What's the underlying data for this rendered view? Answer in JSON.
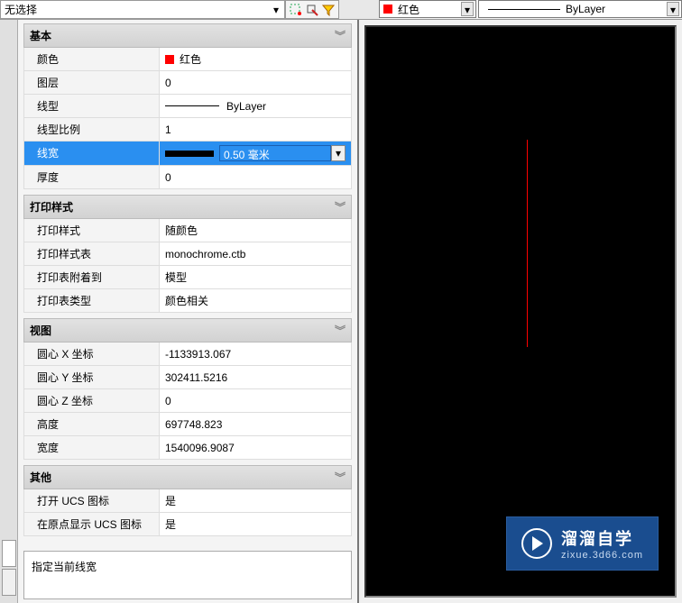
{
  "selection": {
    "label": "无选择"
  },
  "topRight": {
    "color": {
      "swatch": "#f00",
      "label": "红色"
    },
    "linetype": "ByLayer"
  },
  "groups": {
    "basic": {
      "title": "基本",
      "color": {
        "label": "颜色",
        "value": "红色"
      },
      "layer": {
        "label": "图层",
        "value": "0"
      },
      "linetype": {
        "label": "线型",
        "value": "ByLayer"
      },
      "ltscale": {
        "label": "线型比例",
        "value": "1"
      },
      "lineweight": {
        "label": "线宽",
        "value": "0.50 毫米"
      },
      "thickness": {
        "label": "厚度",
        "value": "0"
      }
    },
    "plot": {
      "title": "打印样式",
      "style": {
        "label": "打印样式",
        "value": "随颜色"
      },
      "table": {
        "label": "打印样式表",
        "value": "monochrome.ctb"
      },
      "attached": {
        "label": "打印表附着到",
        "value": "模型"
      },
      "tabletype": {
        "label": "打印表类型",
        "value": "颜色相关"
      }
    },
    "view": {
      "title": "视图",
      "cx": {
        "label": "圆心 X 坐标",
        "value": "-1133913.067"
      },
      "cy": {
        "label": "圆心 Y 坐标",
        "value": "302411.5216"
      },
      "cz": {
        "label": "圆心 Z 坐标",
        "value": "0"
      },
      "height": {
        "label": "高度",
        "value": "697748.823"
      },
      "width": {
        "label": "宽度",
        "value": "1540096.9087"
      }
    },
    "other": {
      "title": "其他",
      "ucsicon": {
        "label": "打开 UCS 图标",
        "value": "是"
      },
      "ucsorigin": {
        "label": "在原点显示 UCS 图标",
        "value": "是"
      }
    }
  },
  "tooltip": "指定当前线宽",
  "watermark": {
    "title": "溜溜自学",
    "sub": "zixue.3d66.com"
  },
  "chevron": "︾"
}
